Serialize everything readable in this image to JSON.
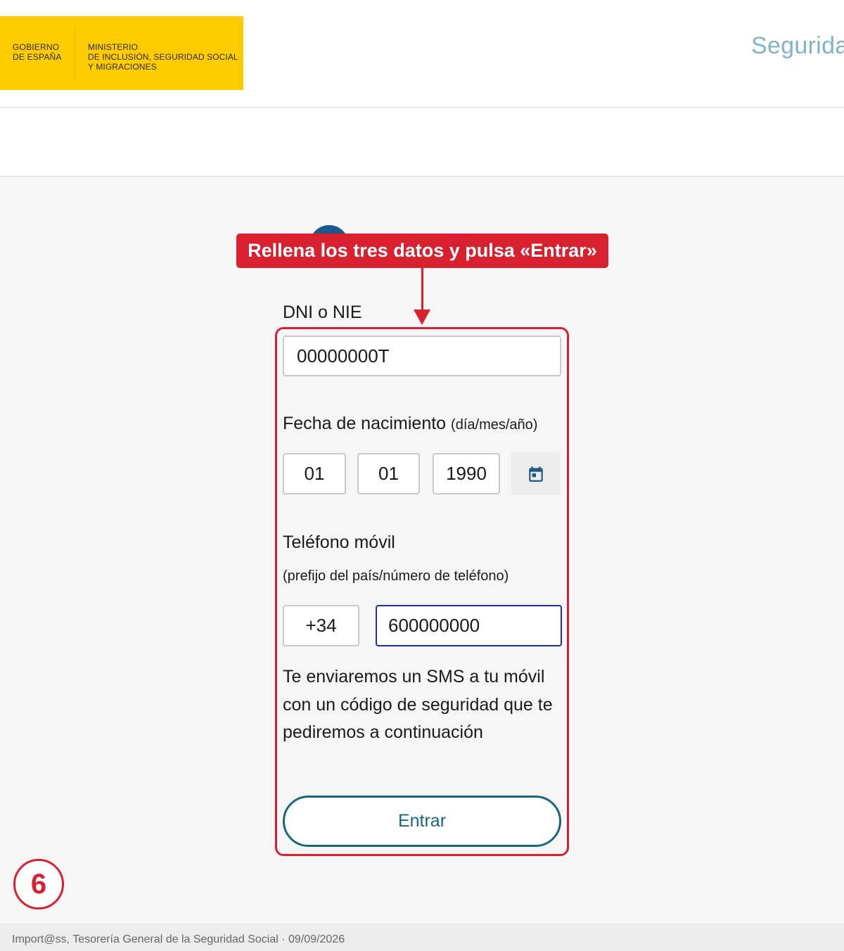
{
  "header": {
    "gov_left_lines": [
      "GOBIERNO",
      "DE ESPAÑA"
    ],
    "gov_right_lines": [
      "MINISTERIO",
      "DE INCLUSIÓN, SEGURIDAD SOCIAL",
      "Y MIGRACIONES"
    ],
    "brand_text": "Seguridad"
  },
  "callout": {
    "text": "Rellena los tres datos y pulsa «Entrar»",
    "color": "#d9202e"
  },
  "form": {
    "dni_label": "DNI o NIE",
    "dni_value": "00000000T",
    "birth_label": "Fecha de nacimiento",
    "birth_format": "(día/mes/año)",
    "birth_day": "01",
    "birth_month": "01",
    "birth_year": "1990",
    "calendar_icon": "calendar-icon",
    "phone_label": "Teléfono móvil",
    "phone_hint": "(prefijo del país/número de teléfono)",
    "phone_prefix": "+34",
    "phone_number": "600000000",
    "sms_note": "Te enviaremos un SMS a tu móvil con un código de seguridad que te pediremos a continuación",
    "submit_label": "Entrar",
    "accent_color": "#16677e"
  },
  "step_badge": "6",
  "footer": {
    "text": "Import@ss, Tesorería General de la Seguridad Social · 09/09/2026"
  }
}
